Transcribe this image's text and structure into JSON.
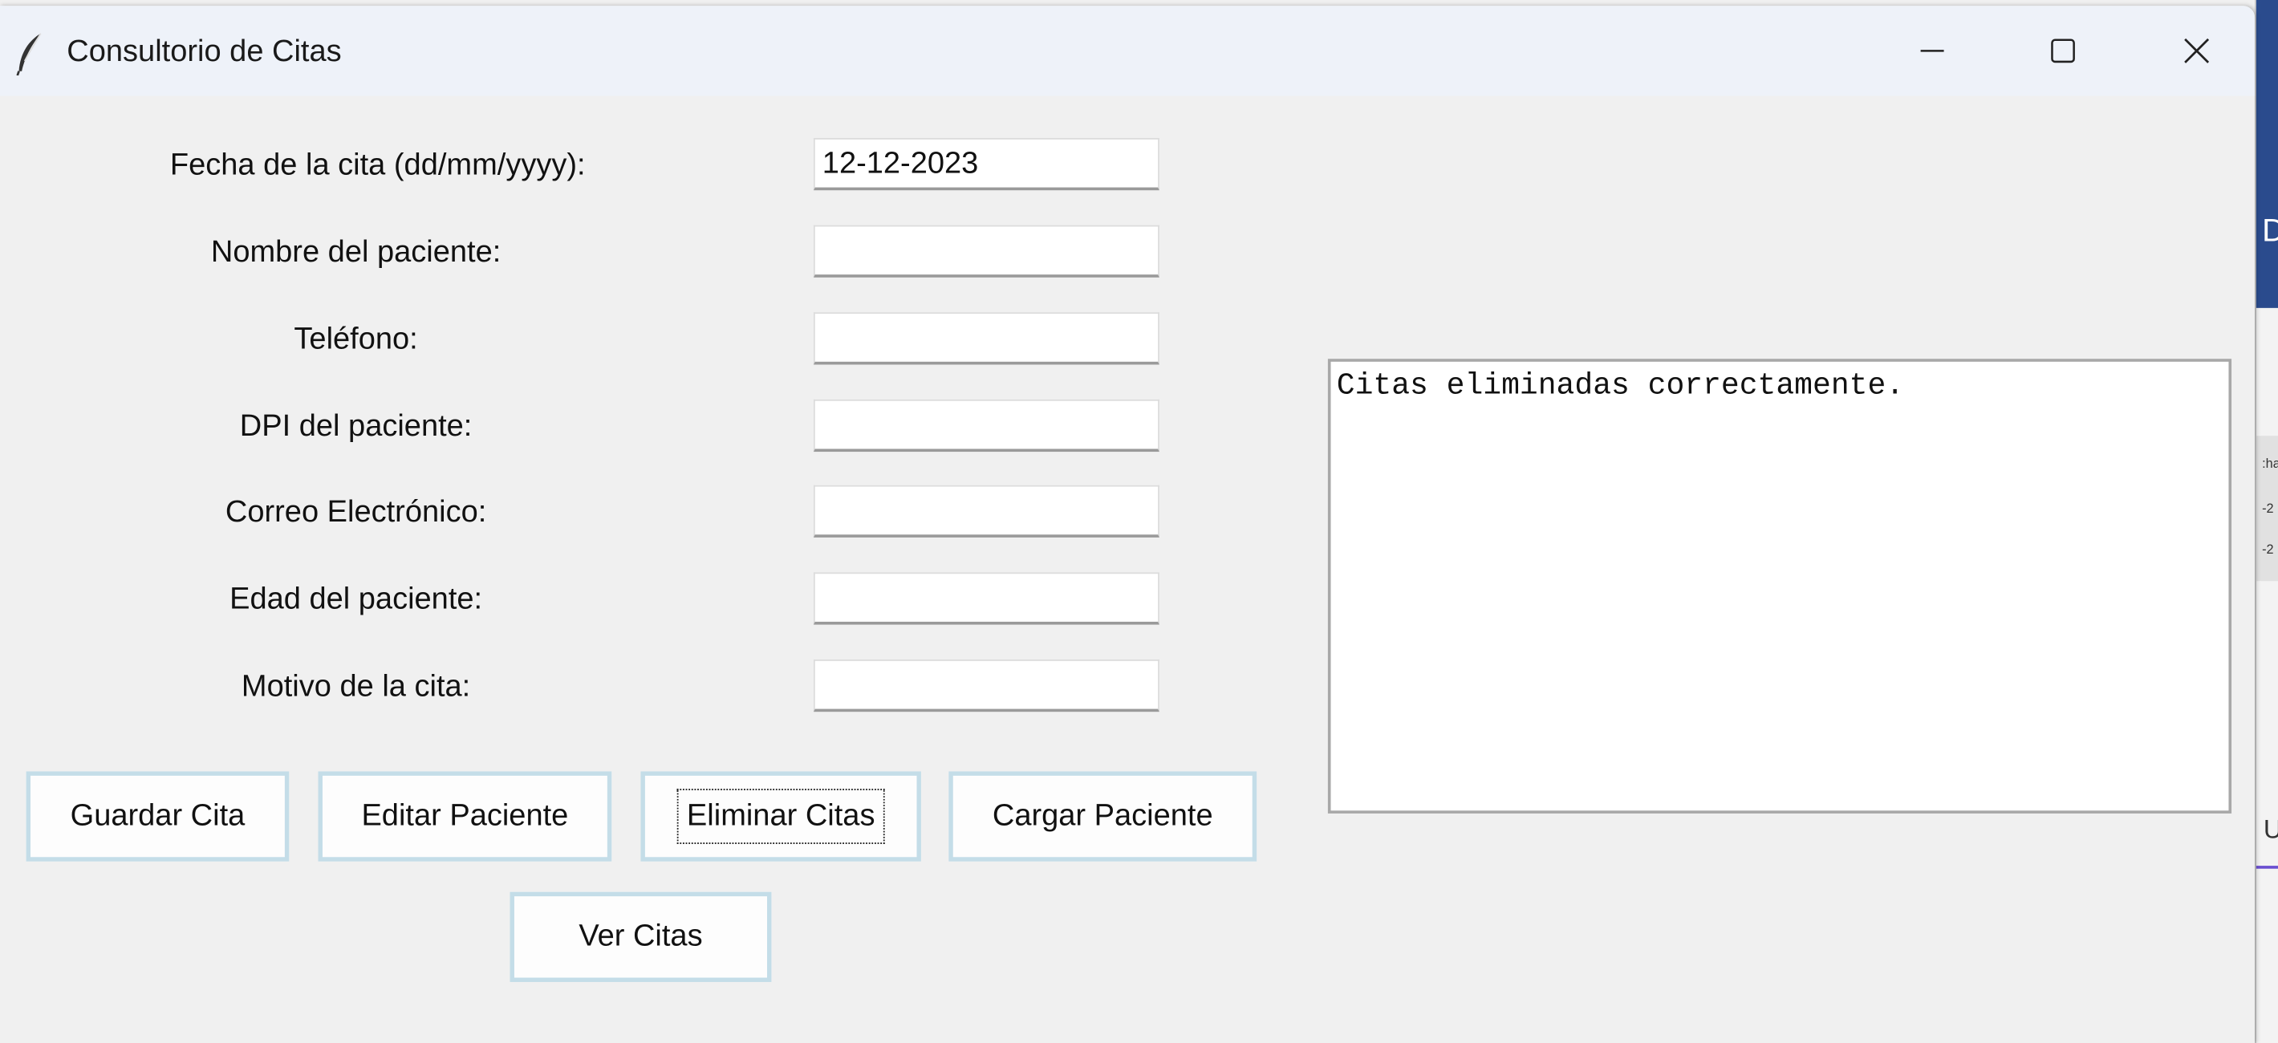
{
  "window": {
    "title": "Consultorio de Citas",
    "controls": [
      "minimize-icon",
      "maximize-icon",
      "close-icon"
    ]
  },
  "form": {
    "fields": [
      {
        "label": "Fecha de la cita (dd/mm/yyyy):",
        "value": "12-12-2023"
      },
      {
        "label": "Nombre del paciente:",
        "value": ""
      },
      {
        "label": "Teléfono:",
        "value": ""
      },
      {
        "label": "DPI del paciente:",
        "value": ""
      },
      {
        "label": "Correo Electrónico:",
        "value": ""
      },
      {
        "label": "Edad del paciente:",
        "value": ""
      },
      {
        "label": "Motivo de la cita:",
        "value": ""
      }
    ]
  },
  "buttons": {
    "guardar": "Guardar Cita",
    "editar": "Editar Paciente",
    "eliminar": "Eliminar Citas",
    "cargar": "Cargar Paciente",
    "ver": "Ver Citas"
  },
  "output": {
    "text": "Citas eliminadas correctamente."
  },
  "background_app": {
    "partial_letters": [
      "D",
      "U"
    ],
    "partial_snippets": [
      ":ha",
      "-2",
      "-2"
    ],
    "accent_colors": {
      "header": "#2a4b8d",
      "underline": "#6b4fd1"
    }
  },
  "colors": {
    "window_bg": "#f0f0f0",
    "titlebar_bg": "#eef2f9",
    "button_border": "#c4dde8"
  }
}
